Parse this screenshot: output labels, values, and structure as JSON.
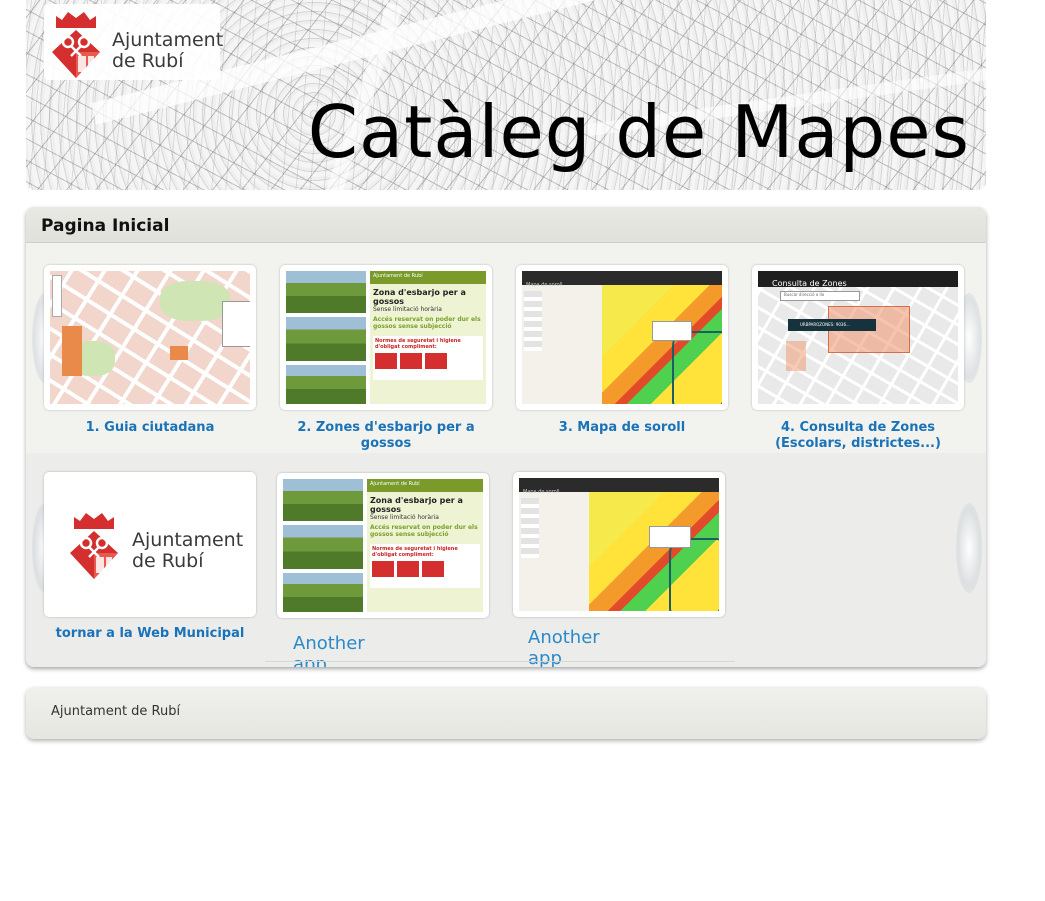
{
  "header": {
    "logo_line1": "Ajuntament",
    "logo_line2": "de Rubí",
    "title": "Catàleg de Mapes"
  },
  "panel": {
    "title": "Pagina Inicial",
    "row1": [
      {
        "label": "1. Guia ciutadana"
      },
      {
        "label": "2. Zones d'esbarjo per a gossos"
      },
      {
        "label": "3. Mapa de soroll"
      },
      {
        "label": "4. Consulta de Zones (Escolars, districtes...)"
      }
    ],
    "row2": [
      {
        "label": "tornar a la Web Municipal"
      },
      {
        "label": "Another app"
      },
      {
        "label": "Another app"
      }
    ],
    "thumb_texts": {
      "poster_brand": "Ajuntament de Rubí",
      "poster_title": "Zona d'esbarjo per a gossos",
      "poster_sub": "Sense limitació horària",
      "poster_green": "Accés reservat on poder dur els gossos sense subjecció",
      "poster_rules": "Normes de seguretat i higiene d'obligat compliment:",
      "poster_rules_b": "Normes de seguretat i higiene d'obligat compliment:",
      "noise_title": "Mapa de soroll",
      "zones_title": "Consulta de Zones",
      "zones_search": "Buscar direcció o llo",
      "zones_popup": "URBPAROZONES: 9036..."
    }
  },
  "footer": {
    "text": "Ajuntament de Rubí"
  },
  "colors": {
    "shield_red": "#d42e2e",
    "link_blue": "#1a73b8",
    "another_blue": "#2a8ac9"
  }
}
